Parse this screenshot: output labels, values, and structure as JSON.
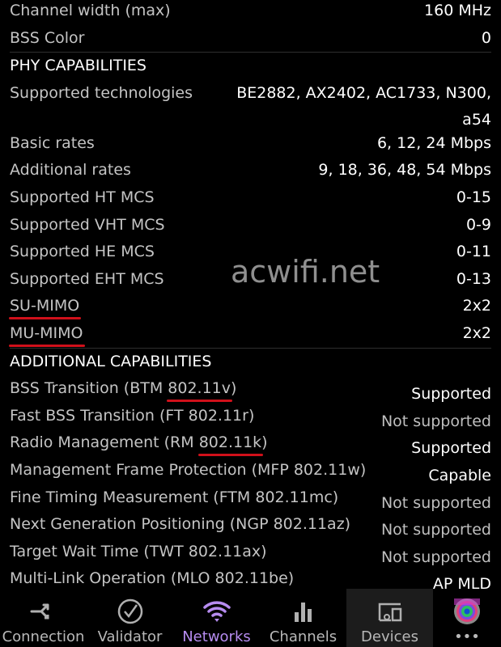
{
  "general": [
    {
      "label": "Channel width (max)",
      "value": "160 MHz"
    },
    {
      "label": "BSS Color",
      "value": "0"
    }
  ],
  "phy": {
    "title": "PHY CAPABILITIES",
    "rows": [
      {
        "label": "Supported technologies",
        "value": "BE2882, AX2402, AC1733, N300, a54"
      },
      {
        "label": "Basic rates",
        "value": "6, 12, 24 Mbps"
      },
      {
        "label": "Additional rates",
        "value": "9, 18, 36, 48, 54 Mbps"
      },
      {
        "label": "Supported HT MCS",
        "value": "0-15"
      },
      {
        "label": "Supported VHT MCS",
        "value": "0-9"
      },
      {
        "label": "Supported HE MCS",
        "value": "0-11"
      },
      {
        "label": "Supported EHT MCS",
        "value": "0-13"
      },
      {
        "label": "SU-MIMO",
        "value": "2x2"
      },
      {
        "label": "MU-MIMO",
        "value": "2x2"
      }
    ]
  },
  "additional": {
    "title": "ADDITIONAL CAPABILITIES",
    "rows": [
      {
        "label_a": "BSS Transition (BTM ",
        "label_u": "802.11v",
        "label_b": ")",
        "value": "Supported"
      },
      {
        "label_a": "Fast BSS Transition (FT 802.11r)",
        "label_u": "",
        "label_b": "",
        "value": "Not supported"
      },
      {
        "label_a": "Radio Management (RM ",
        "label_u": "802.11k",
        "label_b": ")",
        "value": "Supported"
      },
      {
        "label_a": "Management Frame Protection (MFP 802.11w)",
        "label_u": "",
        "label_b": "",
        "value": "Capable"
      },
      {
        "label_a": "Fine Timing Measurement (FTM 802.11mc)",
        "label_u": "",
        "label_b": "",
        "value": "Not supported"
      },
      {
        "label_a": "Next Generation Positioning (NGP 802.11az)",
        "label_u": "",
        "label_b": "",
        "value": "Not supported"
      },
      {
        "label_a": "Target Wait Time (TWT 802.11ax)",
        "label_u": "",
        "label_b": "",
        "value": "Not supported"
      },
      {
        "label_a": "Multi-Link Operation (MLO 802.11be)",
        "label_u": "",
        "label_b": "",
        "value": "AP MLD"
      }
    ]
  },
  "watermark": "acwifi.net",
  "nav": {
    "tabs": [
      {
        "label": "Connection",
        "icon": "connection-icon"
      },
      {
        "label": "Validator",
        "icon": "check-circle-icon"
      },
      {
        "label": "Networks",
        "icon": "wifi-icon",
        "selected": true
      },
      {
        "label": "Channels",
        "icon": "bar-chart-icon"
      },
      {
        "label": "Devices",
        "icon": "devices-icon",
        "highlighted": true
      },
      {
        "label": "•••",
        "icon": "app-logo-icon"
      }
    ],
    "accent": "#b68cf0"
  },
  "colors": {
    "underline": "#d0101a",
    "background": "#000000"
  }
}
